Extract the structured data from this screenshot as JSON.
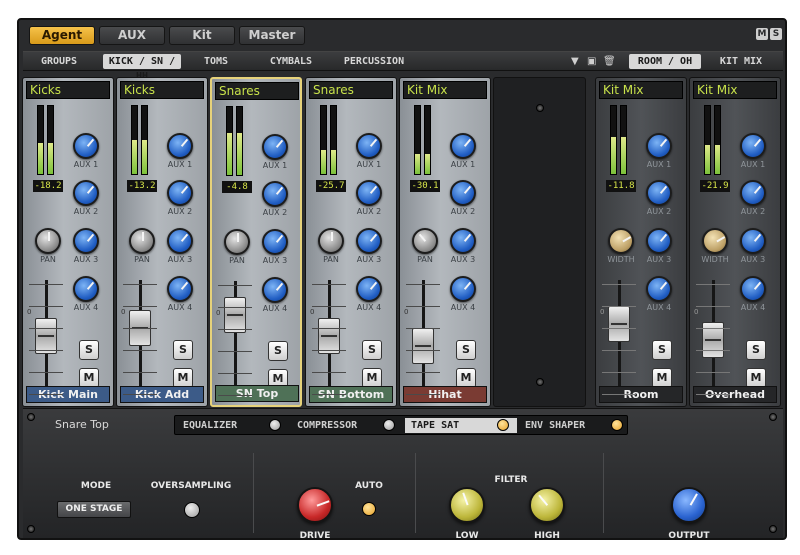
{
  "top_tabs": [
    "Agent",
    "AUX",
    "Kit",
    "Master"
  ],
  "top_tab_active": "Agent",
  "logo_letters": [
    "M",
    "S"
  ],
  "group_tabs": [
    "GROUPS",
    "KICK / SN / HH",
    "TOMS",
    "CYMBALS",
    "PERCUSSION"
  ],
  "group_tab_active": "KICK / SN / HH",
  "view_tabs": [
    "ROOM / OH",
    "KIT MIX"
  ],
  "view_tab_active": "ROOM / OH",
  "aux_labels": [
    "AUX 1",
    "AUX 2",
    "AUX 3",
    "AUX 4"
  ],
  "pan_label": "PAN",
  "width_label": "WIDTH",
  "solo_label": "S",
  "mute_label": "M",
  "fader_zero": "0",
  "channels": [
    {
      "group": "Kicks",
      "name": "Kick Main",
      "level": "-18.2",
      "meter": [
        0.45,
        0.45
      ]
    },
    {
      "group": "Kicks",
      "name": "Kick Add",
      "level": "-13.2",
      "meter": [
        0.5,
        0.5
      ]
    },
    {
      "group": "Snares",
      "name": "SN Top",
      "level": "-4.8",
      "meter": [
        0.62,
        0.62
      ]
    },
    {
      "group": "Snares",
      "name": "SN Bottom",
      "level": "-25.7",
      "meter": [
        0.35,
        0.35
      ]
    },
    {
      "group": "Kit Mix",
      "name": "Hihat",
      "level": "-30.1",
      "meter": [
        0.3,
        0.3
      ]
    },
    {
      "group": "Kit Mix",
      "name": "Room",
      "level": "-11.8",
      "meter": [
        0.55,
        0.55
      ]
    },
    {
      "group": "Kit Mix",
      "name": "Overhead",
      "level": "-21.9",
      "meter": [
        0.42,
        0.42
      ]
    }
  ],
  "fx": {
    "channel_name": "Snare Top",
    "tabs": [
      "EQUALIZER",
      "COMPRESSOR",
      "TAPE SAT",
      "ENV SHAPER"
    ],
    "active_tab": "TAPE SAT",
    "mode_label": "MODE",
    "mode_value": "ONE STAGE",
    "oversampling_label": "OVERSAMPLING",
    "drive_label": "DRIVE",
    "auto_label": "AUTO",
    "filter_label": "FILTER",
    "low_label": "LOW",
    "high_label": "HIGH",
    "output_label": "OUTPUT"
  },
  "colors": {
    "accent": "#e6a92a",
    "group_name": "#c8e24a",
    "kick_label": "#3c5b88",
    "snare_label": "#4f7157",
    "hihat_label": "#7a3b33"
  }
}
